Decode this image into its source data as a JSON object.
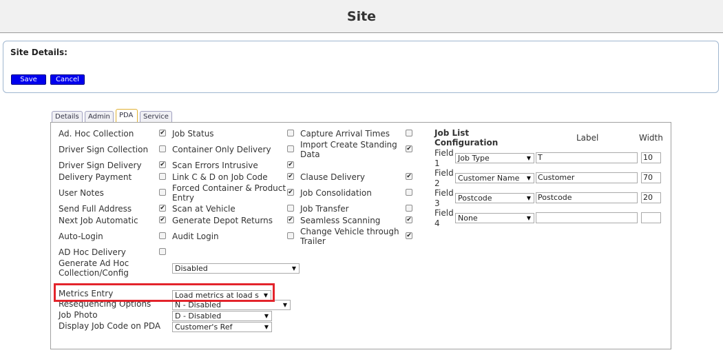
{
  "header": {
    "title": "Site"
  },
  "site_details": {
    "heading": "Site Details:",
    "save_label": "Save",
    "cancel_label": "Cancel"
  },
  "tabs": [
    {
      "label": "Details",
      "active": false
    },
    {
      "label": "Admin",
      "active": false
    },
    {
      "label": "PDA",
      "active": true
    },
    {
      "label": "Service",
      "active": false
    }
  ],
  "pda": {
    "col1": [
      {
        "label": "Ad. Hoc Collection",
        "checked": true
      },
      {
        "label": "Driver Sign Collection",
        "checked": false
      },
      {
        "label": "Driver Sign Delivery",
        "checked": true
      },
      {
        "label": "Delivery Payment",
        "checked": false
      },
      {
        "label": "User Notes",
        "checked": false
      },
      {
        "label": "Send Full Address",
        "checked": true
      },
      {
        "label": "Next Job Automatic",
        "checked": true
      },
      {
        "label": "Auto-Login",
        "checked": false
      },
      {
        "label": "AD Hoc Delivery",
        "checked": false
      }
    ],
    "col2": [
      {
        "label": "Job Status",
        "checked": false
      },
      {
        "label": "Container Only Delivery",
        "checked": false
      },
      {
        "label": "Scan Errors Intrusive",
        "checked": true
      },
      {
        "label": "Link C & D on Job Code",
        "checked": true
      },
      {
        "label": "Forced Container & Product Entry",
        "checked": true
      },
      {
        "label": "Scan at Vehicle",
        "checked": false
      },
      {
        "label": "Generate Depot Returns",
        "checked": true
      },
      {
        "label": "Audit Login",
        "checked": false
      }
    ],
    "col3": [
      {
        "label": "Capture Arrival Times",
        "checked": false
      },
      {
        "label": "Import Create Standing Data",
        "checked": true
      },
      {
        "label": "Clause Delivery",
        "checked": true
      },
      {
        "label": "Job Consolidation",
        "checked": false
      },
      {
        "label": "Job Transfer",
        "checked": false
      },
      {
        "label": "Seamless Scanning",
        "checked": true
      },
      {
        "label": "Change Vehicle through Trailer",
        "checked": true
      }
    ],
    "selects": {
      "generate_adhoc": {
        "label": "Generate Ad Hoc Collection/Config",
        "value": "Disabled"
      },
      "metrics_entry": {
        "label": "Metrics Entry",
        "value": "Load metrics at load s"
      },
      "resequencing": {
        "label": "Resequencing Options",
        "value": "N - Disabled"
      },
      "job_photo": {
        "label": "Job Photo",
        "value": "D - Disabled"
      },
      "display_job_code": {
        "label": "Display Job Code on PDA",
        "value": "Customer's Ref"
      }
    },
    "job_list": {
      "title": "Job List Configuration",
      "label_header": "Label",
      "width_header": "Width",
      "field_word": "Field",
      "fields": [
        {
          "number": "1",
          "type": "Job Type",
          "label": "T",
          "width": "10"
        },
        {
          "number": "2",
          "type": "Customer Name",
          "label": "Customer",
          "width": "70"
        },
        {
          "number": "3",
          "type": "Postcode",
          "label": "Postcode",
          "width": "20"
        },
        {
          "number": "4",
          "type": "None",
          "label": "",
          "width": ""
        }
      ]
    }
  },
  "icons": {
    "checkbox_checked": "✔",
    "dropdown_arrow": "▼"
  }
}
